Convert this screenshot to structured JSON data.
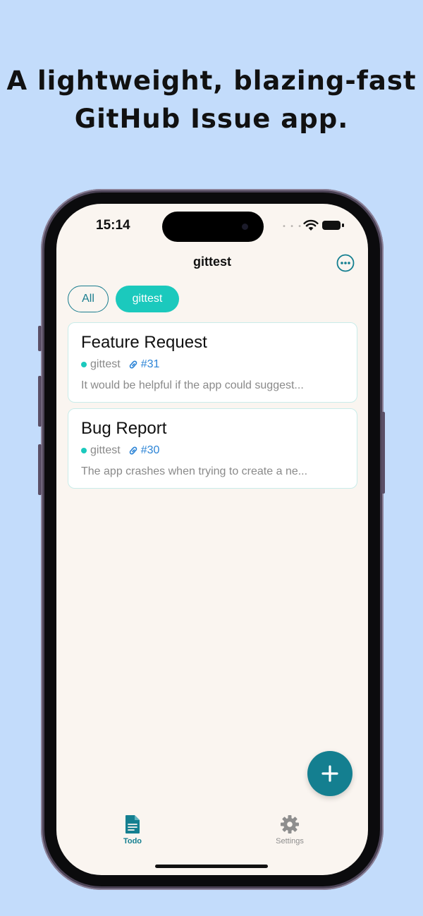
{
  "headline": {
    "line1": "A lightweight, blazing-fast",
    "line2": "GitHub Issue app."
  },
  "status_bar": {
    "time": "15:14",
    "icons": [
      "cellular-dots-icon",
      "wifi-icon",
      "battery-icon"
    ]
  },
  "nav": {
    "title": "gittest",
    "more_icon": "ellipsis-circle-icon"
  },
  "filters": [
    {
      "label": "All",
      "selected": false
    },
    {
      "label": "gittest",
      "selected": true
    }
  ],
  "issues": [
    {
      "title": "Feature Request",
      "repo": "gittest",
      "number": "#31",
      "body": "It would be helpful if the app could suggest..."
    },
    {
      "title": "Bug Report",
      "repo": "gittest",
      "number": "#30",
      "body": "The app crashes when trying to create a ne..."
    }
  ],
  "fab": {
    "icon": "plus-icon"
  },
  "tab_bar": [
    {
      "label": "Todo",
      "icon": "document-icon",
      "active": true
    },
    {
      "label": "Settings",
      "icon": "gear-icon",
      "active": false
    }
  ],
  "colors": {
    "background": "#c3dcfb",
    "screen": "#faf5f0",
    "accent_teal": "#1bc9bd",
    "accent_dark": "#147f90",
    "link_blue": "#2c84d6"
  }
}
